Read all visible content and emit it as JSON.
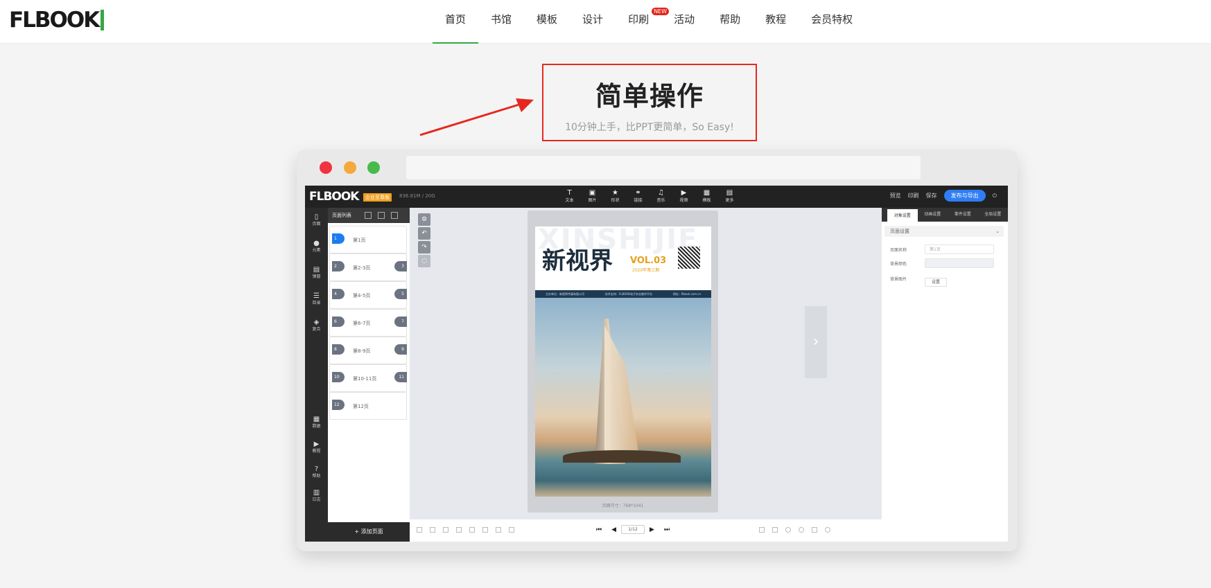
{
  "site": {
    "logo": "FLBOOK",
    "nav": [
      {
        "label": "首页",
        "active": true
      },
      {
        "label": "书馆"
      },
      {
        "label": "模板"
      },
      {
        "label": "设计"
      },
      {
        "label": "印刷",
        "badge": "NEW"
      },
      {
        "label": "活动"
      },
      {
        "label": "帮助"
      },
      {
        "label": "教程"
      },
      {
        "label": "会员特权"
      }
    ]
  },
  "hero": {
    "title": "简单操作",
    "subtitle": "10分钟上手，比PPT更简单，So Easy!"
  },
  "colors": {
    "accent": "#35a844",
    "highlight": "#e5281f",
    "publish": "#2f7ef5"
  },
  "app": {
    "logo": "FLBOOK",
    "edition": "企业至尊版",
    "quota": "836.81M / 20G",
    "tools": [
      {
        "icon": "T",
        "label": "文本"
      },
      {
        "icon": "▣",
        "label": "图片"
      },
      {
        "icon": "★",
        "label": "形状"
      },
      {
        "icon": "⚭",
        "label": "链接"
      },
      {
        "icon": "♫",
        "label": "音乐"
      },
      {
        "icon": "▶",
        "label": "视频"
      },
      {
        "icon": "▦",
        "label": "模板"
      },
      {
        "icon": "▤",
        "label": "更多"
      }
    ],
    "right": {
      "preview": "预览",
      "print": "印刷",
      "save": "保存",
      "publish": "发布与导出"
    },
    "sidebar": [
      {
        "icon": "▯",
        "label": "页面"
      },
      {
        "icon": "●",
        "label": "元素"
      },
      {
        "icon": "▤",
        "label": "弹窗"
      },
      {
        "icon": "☰",
        "label": "目录"
      },
      {
        "icon": "◈",
        "label": "复合"
      },
      {
        "icon": "▦",
        "label": "数据"
      },
      {
        "icon": "▶",
        "label": "教程"
      },
      {
        "icon": "?",
        "label": "帮助"
      },
      {
        "icon": "▥",
        "label": "日志"
      }
    ],
    "pages_title": "页面列表",
    "pages": [
      {
        "n": "1",
        "label": "第1页",
        "on": true
      },
      {
        "n": "2",
        "label": "第2-3页",
        "n2": "3"
      },
      {
        "n": "4",
        "label": "第4-5页",
        "n2": "5"
      },
      {
        "n": "6",
        "label": "第6-7页",
        "n2": "7"
      },
      {
        "n": "8",
        "label": "第8-9页",
        "n2": "9"
      },
      {
        "n": "10",
        "label": "第10-11页",
        "n2": "11"
      },
      {
        "n": "12",
        "label": "第12页"
      }
    ],
    "add_page": "+ 添加页面",
    "cover": {
      "bg_word": "XINSHIJIE",
      "title": "新视界",
      "vol": "VOL.03",
      "year": "2020年第三期",
      "strip": [
        "主办单位：新视界传媒有限公司",
        "技术支持：FLBOOK电子杂志制作平台",
        "网址：flbook.com.cn"
      ],
      "size": "页面尺寸：768*1041"
    },
    "pager": "1/12",
    "right_panel": {
      "tabs": [
        "对象设置",
        "动画设置",
        "事件设置",
        "全局设置"
      ],
      "section": "页面设置",
      "fields": [
        {
          "label": "页面名称",
          "value": "第1页"
        },
        {
          "label": "背景颜色",
          "value": ""
        },
        {
          "label": "背景图片",
          "value": "设置"
        }
      ]
    }
  }
}
